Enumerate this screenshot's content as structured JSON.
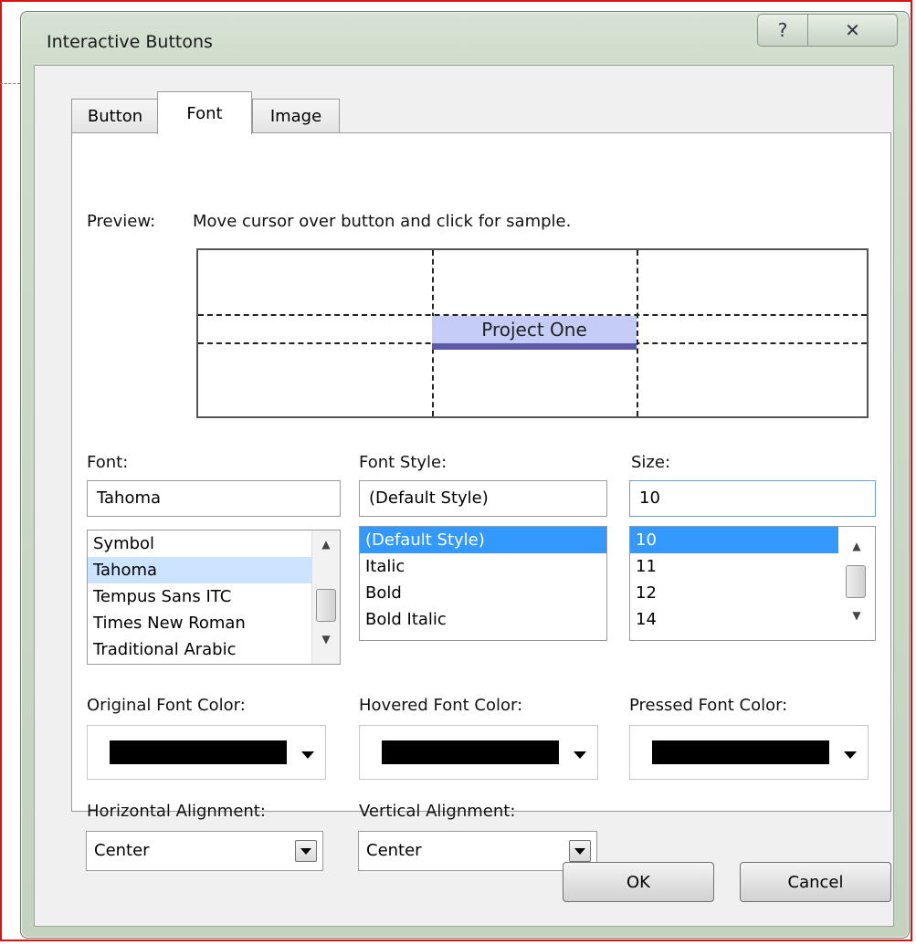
{
  "window": {
    "title": "Interactive Buttons",
    "help_glyph": "?",
    "close_glyph": "✕"
  },
  "tabs": [
    {
      "label": "Button",
      "active": false
    },
    {
      "label": "Font",
      "active": true
    },
    {
      "label": "Image",
      "active": false
    }
  ],
  "preview": {
    "label": "Preview:",
    "hint": "Move cursor over button and click for sample.",
    "sample_text": "Project One"
  },
  "font": {
    "label": "Font:",
    "value": "Tahoma",
    "items": [
      "Symbol",
      "Tahoma",
      "Tempus Sans ITC",
      "Times New Roman",
      "Traditional Arabic"
    ],
    "selected": "Tahoma"
  },
  "font_style": {
    "label": "Font Style:",
    "value": "(Default Style)",
    "items": [
      "(Default Style)",
      "Italic",
      "Bold",
      "Bold Italic"
    ],
    "selected": "(Default Style)"
  },
  "size": {
    "label": "Size:",
    "value": "10",
    "items": [
      "10",
      "11",
      "12",
      "14"
    ],
    "selected": "10"
  },
  "colors": {
    "original": {
      "label": "Original Font Color:",
      "value": "#000000"
    },
    "hovered": {
      "label": "Hovered Font Color:",
      "value": "#000000"
    },
    "pressed": {
      "label": "Pressed Font Color:",
      "value": "#000000"
    }
  },
  "alignment": {
    "horizontal": {
      "label": "Horizontal Alignment:",
      "value": "Center"
    },
    "vertical": {
      "label": "Vertical Alignment:",
      "value": "Center"
    }
  },
  "buttons": {
    "ok": "OK",
    "cancel": "Cancel"
  }
}
